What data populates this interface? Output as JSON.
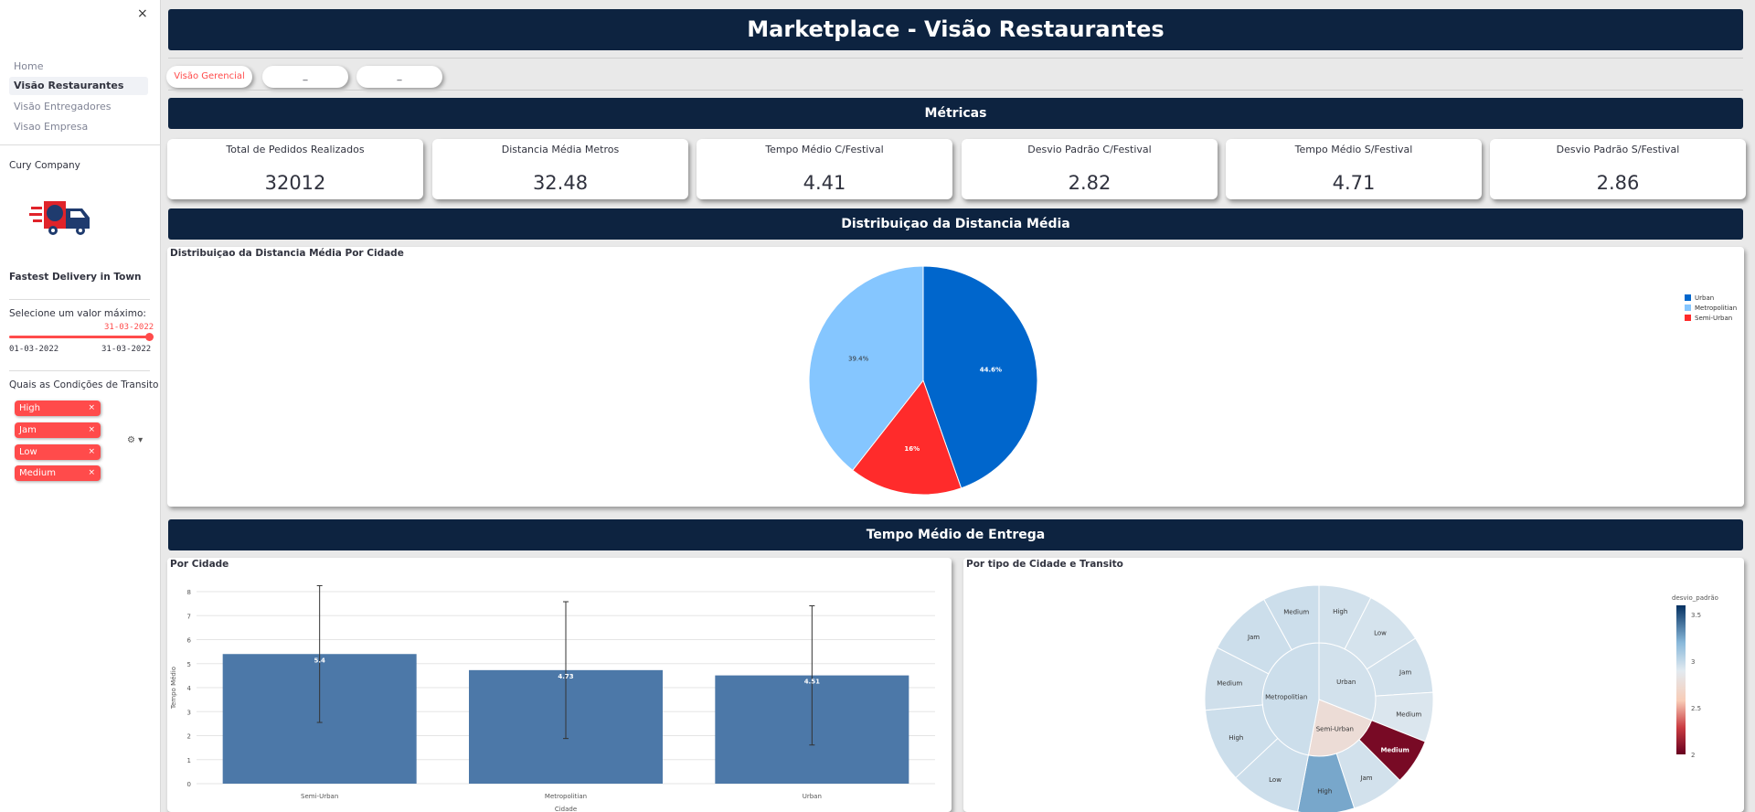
{
  "sidebar": {
    "close": "×",
    "nav": [
      "Home",
      "Visão Restaurantes",
      "Visão Entregadores",
      "Visao Empresa"
    ],
    "company": "Cury Company",
    "tagline": "Fastest Delivery in Town",
    "slider_label": "Selecione um valor máximo:",
    "slider_value": "31-03-2022",
    "slider_min": "01-03-2022",
    "slider_max": "31-03-2022",
    "traffic_label": "Quais as Condições de Transito",
    "traffic_tags": [
      "High",
      "Jam",
      "Low",
      "Medium"
    ],
    "tag_remove": "×",
    "gear": "⚙ ▾"
  },
  "header": {
    "title": "Marketplace - Visão Restaurantes"
  },
  "tabs": [
    "Visão Gerencial",
    "_",
    "_"
  ],
  "sections": {
    "metrics": "Métricas",
    "distribution": "Distribuiçao da Distancia Média",
    "delivery": "Tempo Médio de Entrega"
  },
  "metrics": [
    {
      "label": "Total de Pedidos Realizados",
      "value": "32012"
    },
    {
      "label": "Distancia Média Metros",
      "value": "32.48"
    },
    {
      "label": "Tempo Médio C/Festival",
      "value": "4.41"
    },
    {
      "label": "Desvio Padrão C/Festival",
      "value": "2.82"
    },
    {
      "label": "Tempo Médio S/Festival",
      "value": "4.71"
    },
    {
      "label": "Desvio Padrão S/Festival",
      "value": "2.86"
    }
  ],
  "panels": {
    "pie_title": "Distribuiçao da Distancia Média Por Cidade",
    "bar_title": "Por Cidade",
    "sun_title": "Por tipo de Cidade e Transito"
  },
  "colors": {
    "urban": "#0066cc",
    "metropolitian": "#85c6ff",
    "semi_urban": "#ff2b2b",
    "bar": "#4c78a8",
    "banner": "#0d2340"
  },
  "chart_data": [
    {
      "type": "pie",
      "title": "Distribuiçao da Distancia Média Por Cidade",
      "labels": [
        "Urban",
        "Semi-Urban",
        "Metropolitian"
      ],
      "values": [
        44.6,
        16,
        39.4
      ],
      "value_labels": [
        "44.6%",
        "16%",
        "39.4%"
      ],
      "colors": [
        "#0066cc",
        "#ff2b2b",
        "#85c6ff"
      ],
      "legend": {
        "position": "top-right",
        "entries": [
          "Urban",
          "Metropolitian",
          "Semi-Urban"
        ]
      }
    },
    {
      "type": "bar",
      "title": "Por Cidade",
      "categories": [
        "Semi-Urban",
        "Metropolitian",
        "Urban"
      ],
      "values": [
        5.4,
        4.73,
        4.51
      ],
      "value_labels": [
        "5.4",
        "4.73",
        "4.51"
      ],
      "error": [
        2.85,
        2.85,
        2.9
      ],
      "ylim": [
        0,
        8
      ],
      "yticks": [
        "0",
        "1",
        "2",
        "3",
        "4",
        "5",
        "6",
        "7",
        "8"
      ],
      "xlabel": "Cidade",
      "ylabel": "Tempo Médio",
      "grid": true
    },
    {
      "type": "sunburst",
      "title": "Por tipo de Cidade e Transito",
      "colorbar_title": "desvio_padrão",
      "colorbar_ticks": [
        "3.5",
        "3",
        "2.5",
        "2"
      ],
      "colorbar_range": [
        2,
        3.6
      ],
      "inner": [
        {
          "label": "Urban",
          "share": 0.31,
          "std": 2.95
        },
        {
          "label": "Semi-Urban",
          "share": 0.22,
          "std": 2.75
        },
        {
          "label": "Metropolitian",
          "share": 0.47,
          "std": 2.97
        }
      ],
      "outer": [
        {
          "label": "High",
          "parent": "Urban",
          "share": 0.075,
          "std": 2.95
        },
        {
          "label": "Low",
          "parent": "Urban",
          "share": 0.085,
          "std": 2.94
        },
        {
          "label": "Jam",
          "parent": "Urban",
          "share": 0.08,
          "std": 2.95
        },
        {
          "label": "Medium",
          "parent": "Urban",
          "share": 0.07,
          "std": 2.92
        },
        {
          "label": "Medium",
          "parent": "Semi-Urban",
          "share": 0.065,
          "std": 2.05
        },
        {
          "label": "Jam",
          "parent": "Semi-Urban",
          "share": 0.075,
          "std": 2.95
        },
        {
          "label": "High",
          "parent": "Semi-Urban",
          "share": 0.08,
          "std": 3.25
        },
        {
          "label": "Low",
          "parent": "Metropolitian",
          "share": 0.1,
          "std": 2.97
        },
        {
          "label": "High",
          "parent": "Metropolitian",
          "share": 0.105,
          "std": 2.97
        },
        {
          "label": "Medium",
          "parent": "Metropolitian",
          "share": 0.09,
          "std": 2.96
        },
        {
          "label": "Jam",
          "parent": "Metropolitian",
          "share": 0.095,
          "std": 2.97
        },
        {
          "label": "Medium",
          "parent": "Metropolitian",
          "share": 0.08,
          "std": 2.97
        }
      ]
    }
  ]
}
